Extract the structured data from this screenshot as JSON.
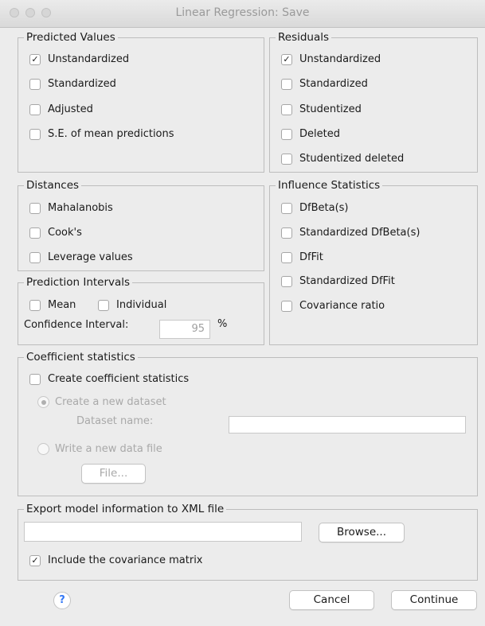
{
  "window": {
    "title": "Linear Regression: Save"
  },
  "predicted": {
    "legend": "Predicted Values",
    "items": [
      {
        "label": "Unstandardized",
        "checked": true
      },
      {
        "label": "Standardized",
        "checked": false
      },
      {
        "label": "Adjusted",
        "checked": false
      },
      {
        "label": "S.E. of mean predictions",
        "checked": false
      }
    ]
  },
  "residuals": {
    "legend": "Residuals",
    "items": [
      {
        "label": "Unstandardized",
        "checked": true
      },
      {
        "label": "Standardized",
        "checked": false
      },
      {
        "label": "Studentized",
        "checked": false
      },
      {
        "label": "Deleted",
        "checked": false
      },
      {
        "label": "Studentized deleted",
        "checked": false
      }
    ]
  },
  "distances": {
    "legend": "Distances",
    "items": [
      {
        "label": "Mahalanobis",
        "checked": false
      },
      {
        "label": "Cook's",
        "checked": false
      },
      {
        "label": "Leverage values",
        "checked": false
      }
    ]
  },
  "influence": {
    "legend": "Influence Statistics",
    "items": [
      {
        "label": "DfBeta(s)",
        "checked": false
      },
      {
        "label": "Standardized DfBeta(s)",
        "checked": false
      },
      {
        "label": "DfFit",
        "checked": false
      },
      {
        "label": "Standardized DfFit",
        "checked": false
      },
      {
        "label": "Covariance ratio",
        "checked": false
      }
    ]
  },
  "prediction_intervals": {
    "legend": "Prediction Intervals",
    "mean_label": "Mean",
    "individual_label": "Individual",
    "confidence_label": "Confidence Interval:",
    "confidence_value": "95",
    "percent": "%"
  },
  "coefficient": {
    "legend": "Coefficient statistics",
    "create_label": "Create coefficient statistics",
    "new_dataset_label": "Create a new dataset",
    "dataset_name_label": "Dataset name:",
    "dataset_name_value": "",
    "write_file_label": "Write a new data file",
    "file_button": "File..."
  },
  "export": {
    "legend": "Export model information to XML file",
    "path_value": "",
    "browse_button": "Browse...",
    "include_cov_label": "Include the covariance matrix",
    "include_cov_checked": true
  },
  "footer": {
    "help_glyph": "?",
    "cancel_button": "Cancel",
    "continue_button": "Continue"
  },
  "checkmark_glyph": "✓"
}
